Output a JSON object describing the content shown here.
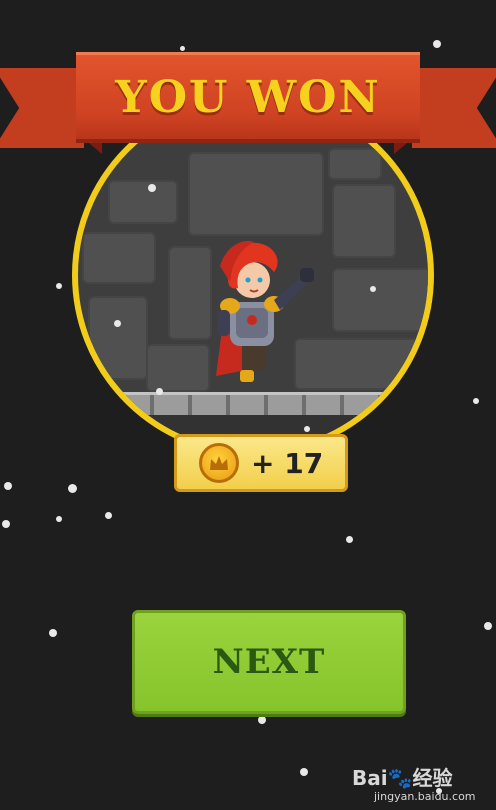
{
  "banner": {
    "title": "YOU WON"
  },
  "reward": {
    "amount_text": "+ 17",
    "icon": "coin-icon"
  },
  "buttons": {
    "next_label": "NEXT"
  },
  "watermark": {
    "brand": "Bai🐾经验",
    "url": "jingyan.baidu.com"
  },
  "colors": {
    "background": "#1f1e1f",
    "banner": "#cf4323",
    "banner_text": "#f6d21e",
    "ring": "#f2cc1a",
    "next_button": "#8fcb32",
    "next_text": "#2a5a12"
  }
}
